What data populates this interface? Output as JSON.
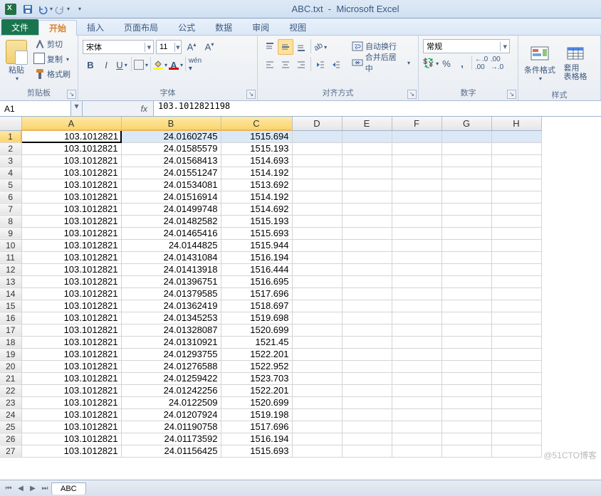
{
  "title_doc": "ABC.txt",
  "title_app": "Microsoft Excel",
  "tabs": {
    "file": "文件",
    "home": "开始",
    "insert": "插入",
    "layout": "页面布局",
    "formulas": "公式",
    "data": "数据",
    "review": "审阅",
    "view": "视图"
  },
  "ribbon": {
    "clipboard": {
      "label": "剪贴板",
      "paste": "粘贴",
      "cut": "剪切",
      "copy": "复制",
      "brush": "格式刷"
    },
    "font": {
      "label": "字体",
      "name": "宋体",
      "size": "11"
    },
    "align": {
      "label": "对齐方式",
      "wrap": "自动换行",
      "merge": "合并后居中"
    },
    "number": {
      "label": "数字",
      "format": "常规"
    },
    "styles": {
      "label": "样式",
      "cond": "条件格式",
      "format_as": "套用\n表格格"
    }
  },
  "namebox": "A1",
  "formula": "103.1012821198",
  "columns": [
    "A",
    "B",
    "C",
    "D",
    "E",
    "F",
    "G",
    "H"
  ],
  "active_cell": {
    "row": 0,
    "col": 0
  },
  "selected_columns": [
    "A",
    "B",
    "C"
  ],
  "chart_data": {
    "type": "table",
    "columns": [
      "A",
      "B",
      "C"
    ],
    "rows": [
      [
        "103.1012821",
        "24.01602745",
        "1515.694"
      ],
      [
        "103.1012821",
        "24.01585579",
        "1515.193"
      ],
      [
        "103.1012821",
        "24.01568413",
        "1514.693"
      ],
      [
        "103.1012821",
        "24.01551247",
        "1514.192"
      ],
      [
        "103.1012821",
        "24.01534081",
        "1513.692"
      ],
      [
        "103.1012821",
        "24.01516914",
        "1514.192"
      ],
      [
        "103.1012821",
        "24.01499748",
        "1514.692"
      ],
      [
        "103.1012821",
        "24.01482582",
        "1515.193"
      ],
      [
        "103.1012821",
        "24.01465416",
        "1515.693"
      ],
      [
        "103.1012821",
        "24.0144825",
        "1515.944"
      ],
      [
        "103.1012821",
        "24.01431084",
        "1516.194"
      ],
      [
        "103.1012821",
        "24.01413918",
        "1516.444"
      ],
      [
        "103.1012821",
        "24.01396751",
        "1516.695"
      ],
      [
        "103.1012821",
        "24.01379585",
        "1517.696"
      ],
      [
        "103.1012821",
        "24.01362419",
        "1518.697"
      ],
      [
        "103.1012821",
        "24.01345253",
        "1519.698"
      ],
      [
        "103.1012821",
        "24.01328087",
        "1520.699"
      ],
      [
        "103.1012821",
        "24.01310921",
        "1521.45"
      ],
      [
        "103.1012821",
        "24.01293755",
        "1522.201"
      ],
      [
        "103.1012821",
        "24.01276588",
        "1522.952"
      ],
      [
        "103.1012821",
        "24.01259422",
        "1523.703"
      ],
      [
        "103.1012821",
        "24.01242256",
        "1522.201"
      ],
      [
        "103.1012821",
        "24.0122509",
        "1520.699"
      ],
      [
        "103.1012821",
        "24.01207924",
        "1519.198"
      ],
      [
        "103.1012821",
        "24.01190758",
        "1517.696"
      ],
      [
        "103.1012821",
        "24.01173592",
        "1516.194"
      ],
      [
        "103.1012821",
        "24.01156425",
        "1515.693"
      ]
    ]
  },
  "sheet_name": "ABC",
  "watermark": "@51CTO博客"
}
